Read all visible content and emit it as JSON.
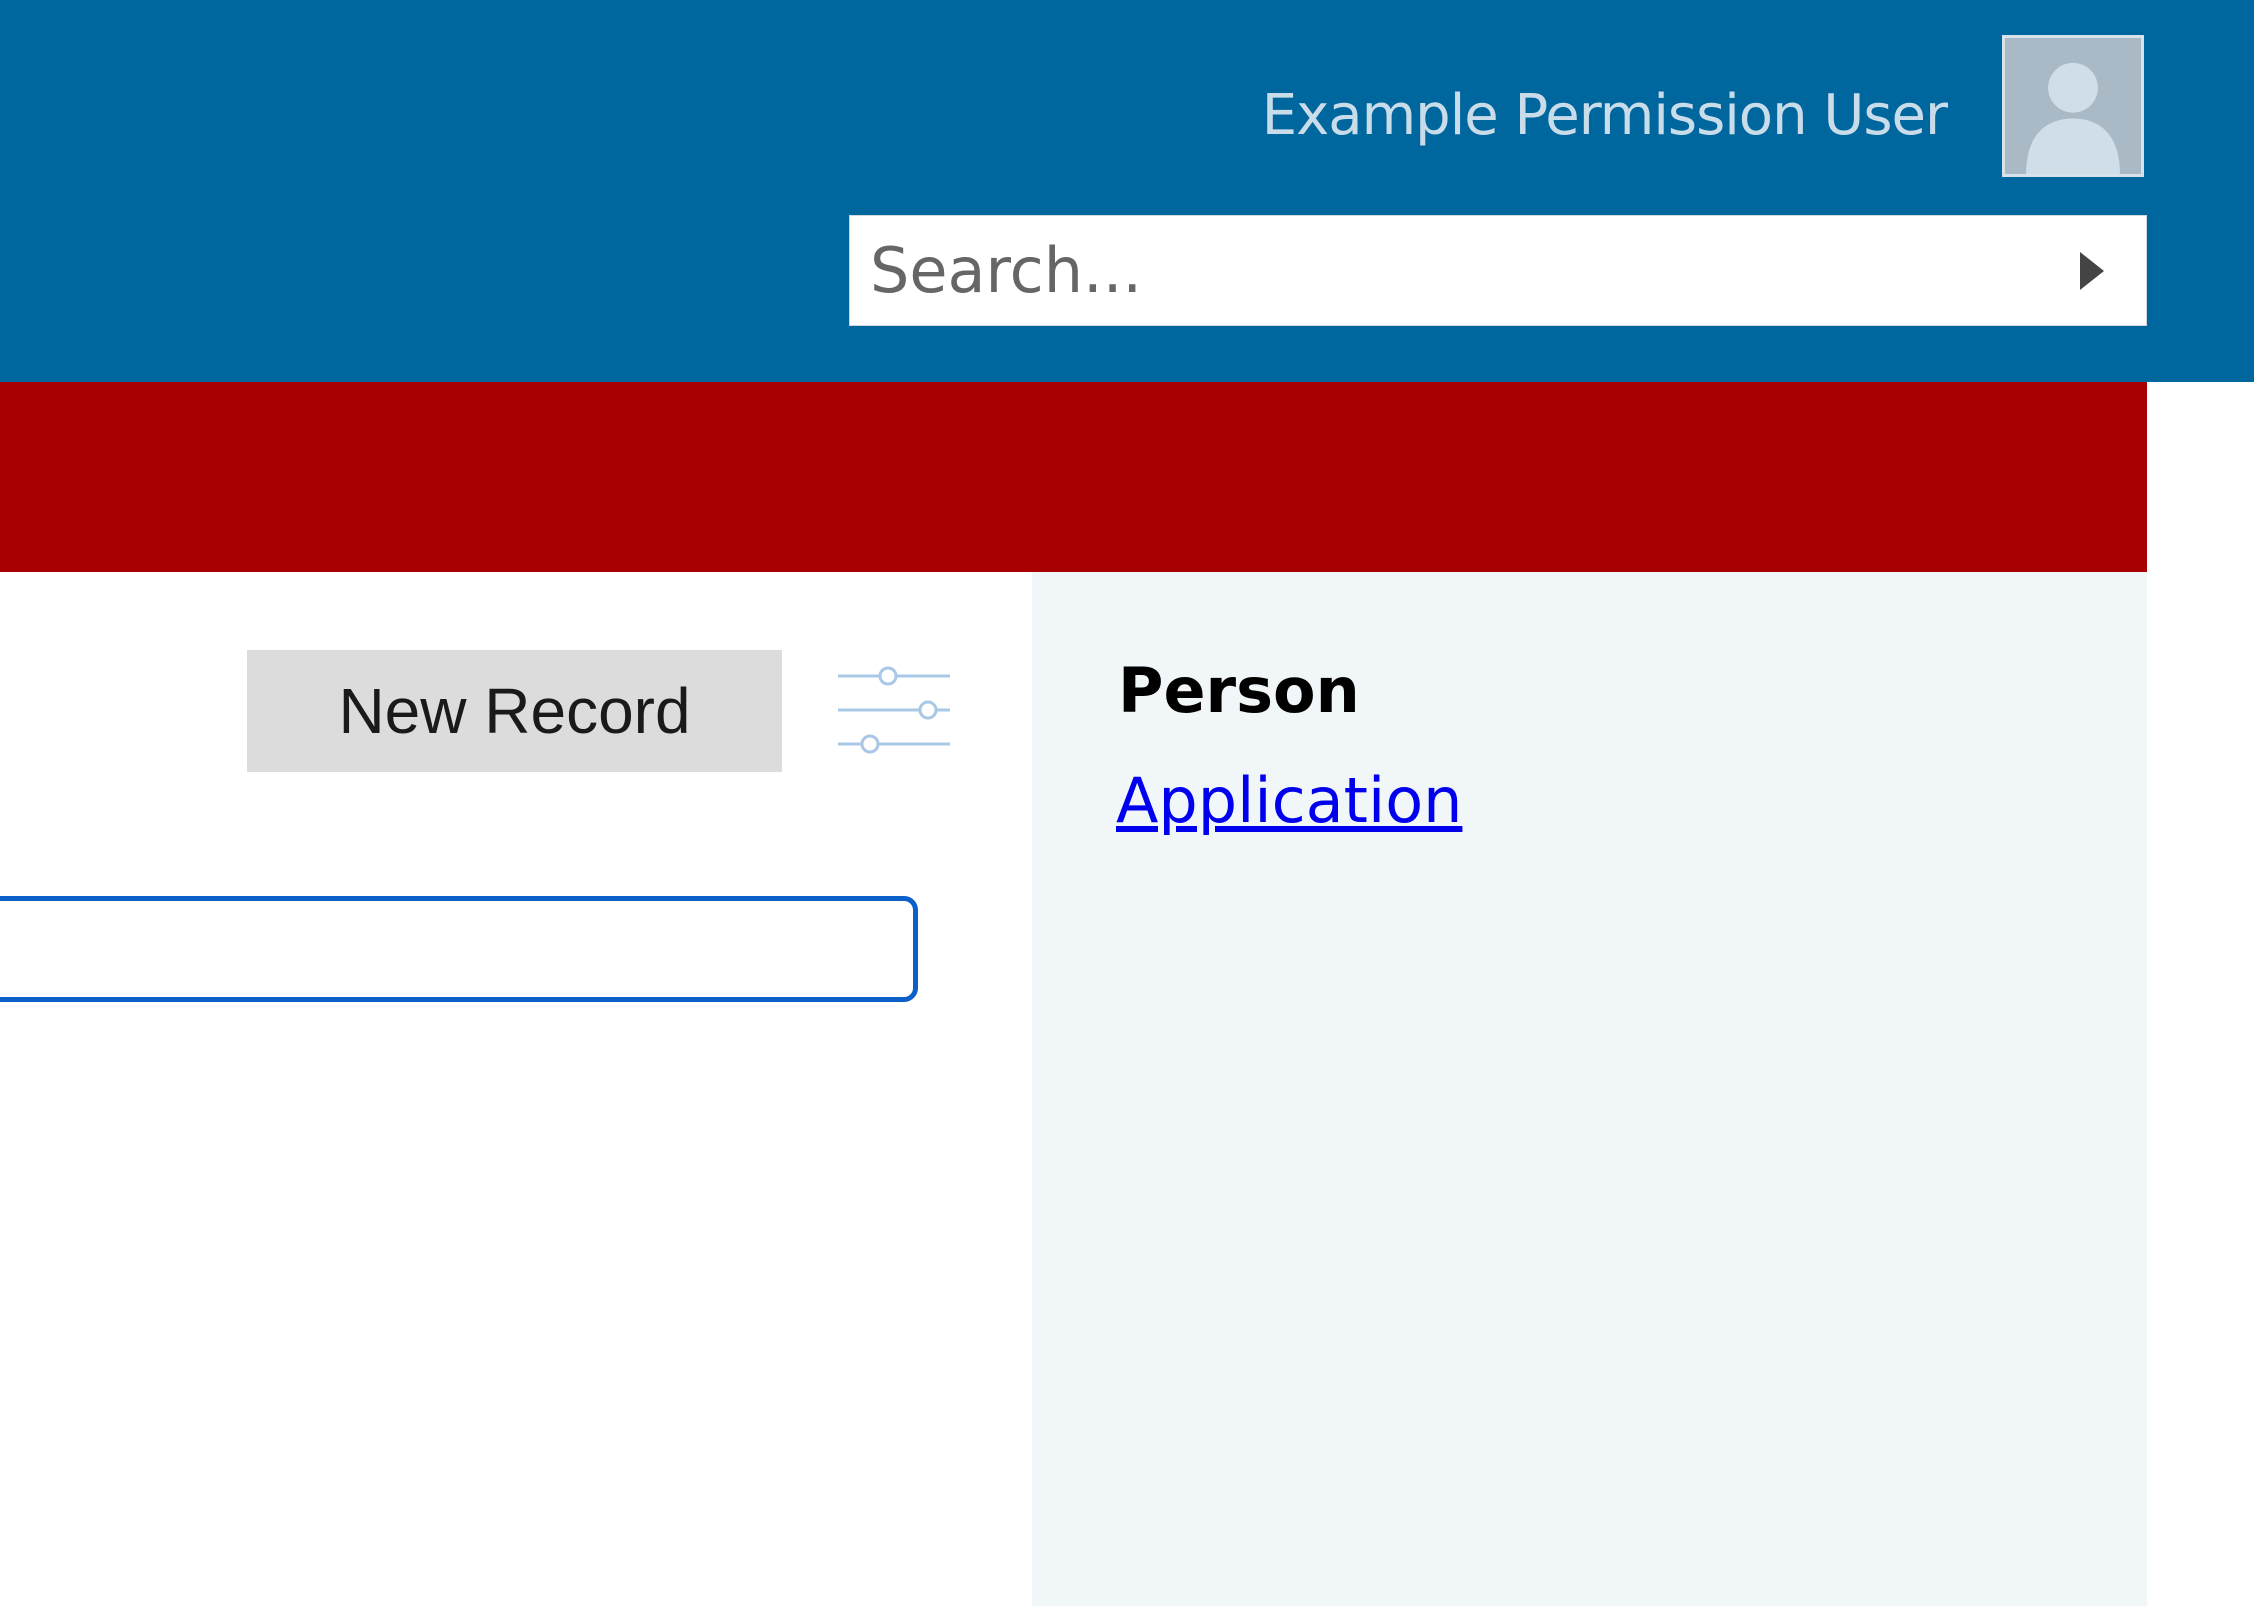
{
  "header": {
    "user_name": "Example Permission User",
    "search": {
      "placeholder": "Search...",
      "value": ""
    }
  },
  "toolbar": {
    "new_record_label": "New Record"
  },
  "record_search": {
    "value": ""
  },
  "side_panel": {
    "title": "Person",
    "link_label": "Application"
  },
  "icons": {
    "avatar": "user-avatar-icon",
    "search_go": "triangle-right-icon",
    "filter": "sliders-icon"
  },
  "colors": {
    "header_bg": "#00669e",
    "banner_bg": "#a80000",
    "panel_bg": "#f1f6f9",
    "link": "#0000ee",
    "focus_border": "#0a5fc9"
  }
}
